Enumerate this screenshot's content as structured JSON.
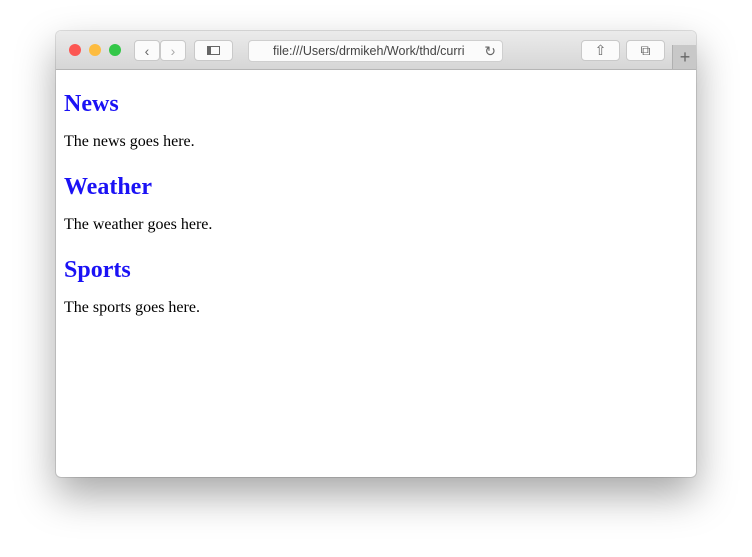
{
  "browser": {
    "url": "file:///Users/drmikeh/Work/thd/curri",
    "colors": {
      "close": "#fc5753",
      "minimize": "#fdbc40",
      "zoom": "#33c748"
    }
  },
  "sections": [
    {
      "heading": "News",
      "body": "The news goes here."
    },
    {
      "heading": "Weather",
      "body": "The weather goes here."
    },
    {
      "heading": "Sports",
      "body": "The sports goes here."
    }
  ]
}
